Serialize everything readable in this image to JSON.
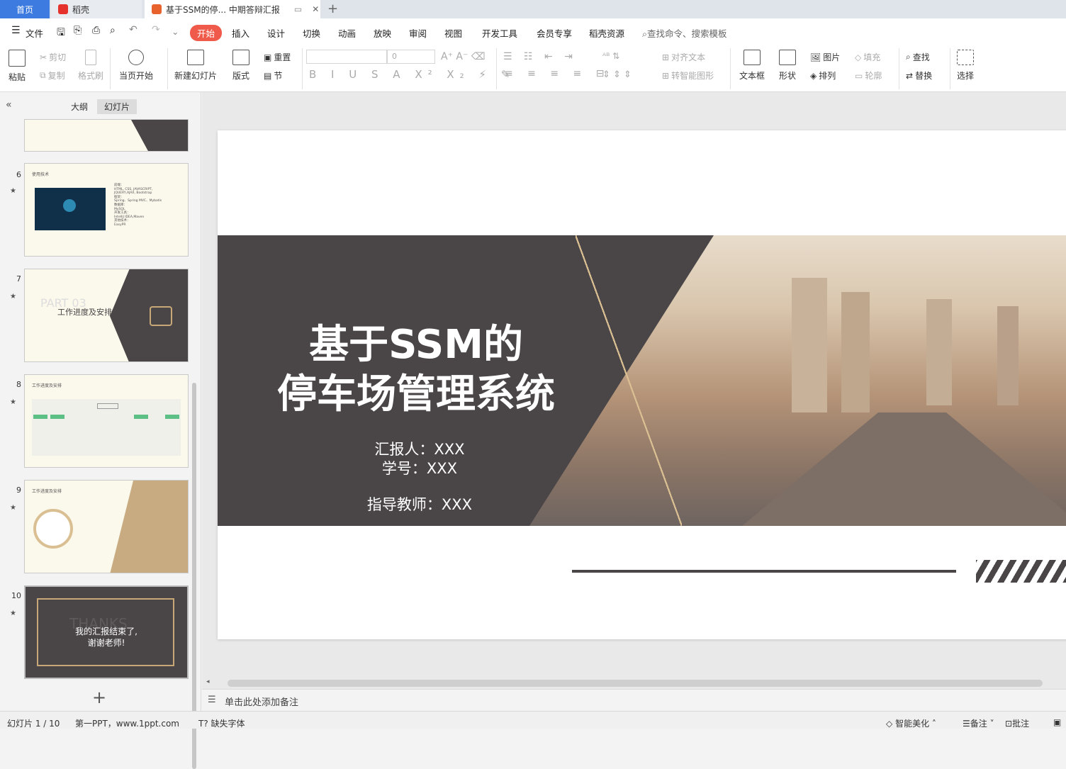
{
  "tabs": {
    "home": "首页",
    "daoke": "稻壳",
    "doc": "基于SSM的停... 中期答辩汇报"
  },
  "menu": {
    "file": "文件",
    "items": [
      "开始",
      "插入",
      "设计",
      "切换",
      "动画",
      "放映",
      "审阅",
      "视图",
      "开发工具",
      "会员专享",
      "稻壳资源"
    ],
    "search": "查找命令、搜索模板"
  },
  "ribbon": {
    "paste": "粘贴",
    "cut": "剪切",
    "copy": "复制",
    "format_painter": "格式刷",
    "from_current": "当页开始",
    "new_slide": "新建幻灯片",
    "layout": "版式",
    "reset": "重置",
    "section": "节",
    "font_size": "0",
    "align_text": "对齐文本",
    "smart_shape": "转智能图形",
    "textbox": "文本框",
    "shape": "形状",
    "picture": "图片",
    "arrange": "排列",
    "fill": "填充",
    "outline": "轮廓",
    "find": "查找",
    "replace": "替换",
    "select": "选择"
  },
  "panel": {
    "outline": "大纲",
    "slides": "幻灯片"
  },
  "thumbs": [
    {
      "num": "6",
      "title": "使用技术",
      "body": [
        "前端：",
        "HTML, CSS, JAVASCRIPT,",
        "JQUERY,AJAX, Bootstrap",
        "框架：",
        "Spring、Spring MVC、Mybatis",
        "数据库：",
        "MySQL",
        "开发工具：",
        "IntelliJ IDEA,Maven",
        "其他技术：",
        "EasyPR"
      ]
    },
    {
      "num": "7",
      "part": "PART 03",
      "title": "工作进度及安排"
    },
    {
      "num": "8",
      "title": "工作进度及安排"
    },
    {
      "num": "9",
      "title": "工作进度及安排"
    },
    {
      "num": "10",
      "line1": "我的汇报结束了,",
      "line2": "谢谢老师!",
      "bg": "THANKS"
    }
  ],
  "slide": {
    "title1": "基于SSM的",
    "title2": "停车场管理系统",
    "reporter": "汇报人：XXX",
    "student_id": "学号：XXX",
    "advisor": "指导教师：XXX"
  },
  "notes": "单击此处添加备注",
  "status": {
    "slide_count": "幻灯片 1 / 10",
    "theme": "第一PPT，www.1ppt.com",
    "missing_font": "缺失字体",
    "beautify": "智能美化",
    "notes_btn": "备注",
    "comment": "批注"
  },
  "colors": {
    "accent": "#f05a4a",
    "home_tab": "#3d7be0",
    "dark": "#4a4648",
    "gold": "#c9a878"
  }
}
